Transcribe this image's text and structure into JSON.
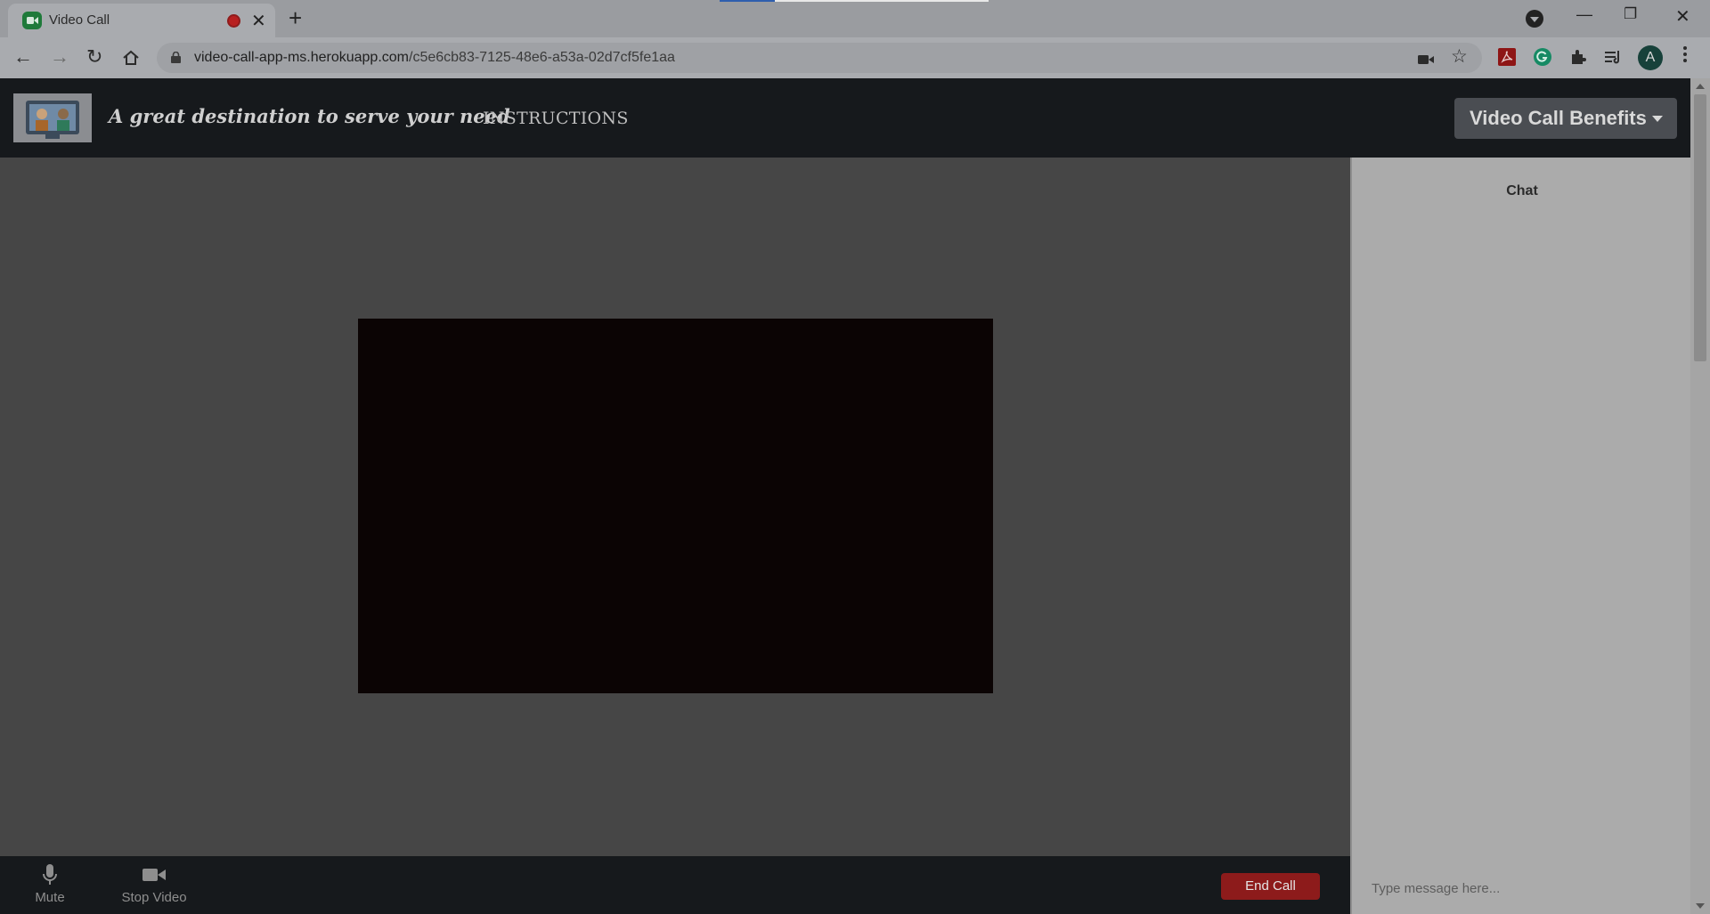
{
  "browser": {
    "tab_title": "Video Call",
    "url_host": "video-call-app-ms.herokuapp.com",
    "url_path": "/c5e6cb83-7125-48e6-a53a-02d7cf5fe1aa",
    "profile_initial": "A",
    "icons": [
      "video-call-favicon",
      "recording-icon",
      "close-icon",
      "plus-icon",
      "back-icon",
      "forward-icon",
      "reload-icon",
      "home-icon",
      "lock-icon",
      "camera-icon",
      "star-icon",
      "pdf-extension-icon",
      "grammarly-icon",
      "extensions-icon",
      "reading-list-icon",
      "menu-icon",
      "minimize-icon",
      "maximize-icon",
      "window-close-icon"
    ]
  },
  "navbar": {
    "tagline": "A great destination to serve your need",
    "instructions_link": "INSTRUCTIONS",
    "benefits_button": "Video Call Benefits"
  },
  "controls": {
    "mute_label": "Mute",
    "stop_video_label": "Stop Video",
    "end_call_label": "End Call"
  },
  "chat": {
    "title": "Chat",
    "input_placeholder": "Type message here..."
  },
  "colors": {
    "end_call": "#8d1b1b",
    "navbar": "#16191c",
    "video_bg": "#0b0404"
  }
}
